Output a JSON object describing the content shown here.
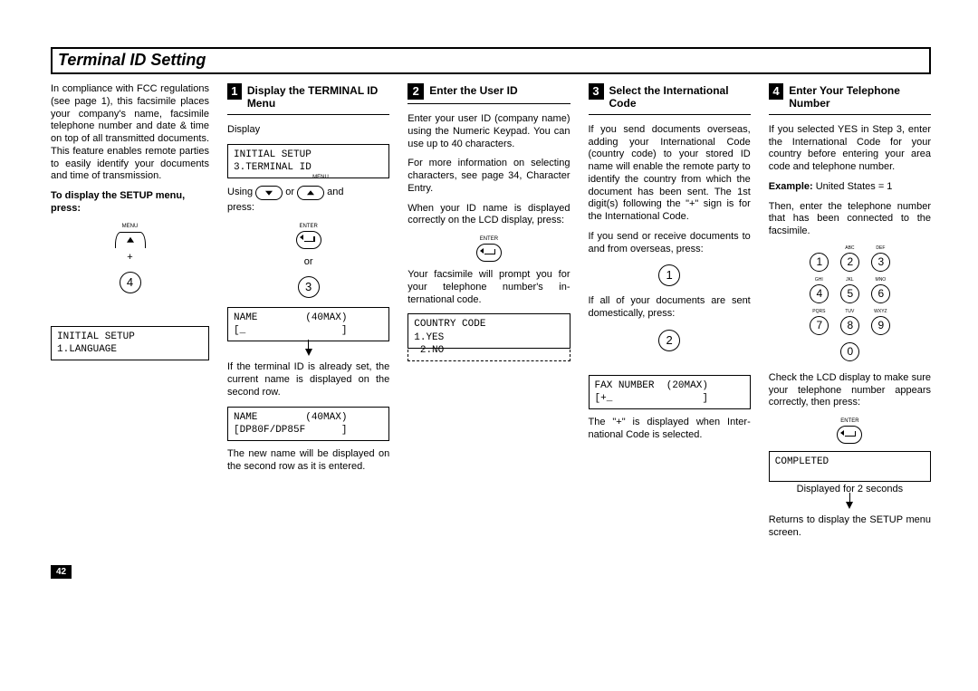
{
  "title": "Terminal ID Setting",
  "page_number": "42",
  "intro": {
    "p1": "In compliance with FCC regula­tions (see page 1), this facsimile places your company's name, facsimile telephone number and date & time on top of all trans­mitted documents. This feature enables remote parties to easily identify your documents and time of transmission.",
    "bold_line": "To display the SETUP menu, press:",
    "plus": "+",
    "key4": "4",
    "menu_label": "MENU",
    "lcd1_l1": "INITIAL SETUP",
    "lcd1_l2": "1.LANGUAGE"
  },
  "step1": {
    "num": "1",
    "title": "Display the TERMINAL ID Menu",
    "display_word": "Display",
    "lcd1_l1": "INITIAL SETUP",
    "lcd1_l2": "3.TERMINAL ID",
    "using": "Using",
    "or_word": "or",
    "and_word": "and",
    "press_word": "press:",
    "enter_label": "ENTER",
    "menu_label": "MENU",
    "key3": "3",
    "lcd2_l1": "NAME        (40MAX)",
    "lcd2_l2": "[_                ]",
    "p1": "If the terminal ID is already set, the current name is displayed on the second row.",
    "lcd3_l1": "NAME        (40MAX)",
    "lcd3_l2": "[DP80F/DP85F      ]",
    "p2": "The new name will be displayed on the second row as it is en­tered."
  },
  "step2": {
    "num": "2",
    "title": "Enter the User ID",
    "p1": "Enter your user ID (company name) using the Numeric Key­pad. You can use up to 40 char­acters.",
    "p2": "For more information on select­ing characters, see page 34, Character Entry.",
    "p3": "When your ID name is displayed correctly on the LCD display, press:",
    "enter_label": "ENTER",
    "p4": "Your facsimile will prompt you for your telephone number's in­ternational code.",
    "lcd1_l1": "COUNTRY CODE",
    "lcd1_l2": "1.YES",
    "lcd1_l3": " 2.NO"
  },
  "step3": {
    "num": "3",
    "title": "Select the International Code",
    "p1": "If you send documents over­seas, adding your International Code (country code) to your stored ID name will enable the remote party to identify the country from which the docu­ment has been sent. The 1st digit(s) following the \"+\" sign is for the International Code.",
    "p2": "If you send or receive docu­ments to and from overseas, press:",
    "key1": "1",
    "p3": "If all of your documents are sent domestically, press:",
    "key2": "2",
    "lcd1_l1": "FAX NUMBER  (20MAX)",
    "lcd1_l2": "[+_               ]",
    "p4": "The \"+\" is displayed when Inter­national Code is selected."
  },
  "step4": {
    "num": "4",
    "title": "Enter Your Telephone Number",
    "p1": "If you selected YES in Step 3, enter the International Code for your country before entering your area code and telephone number.",
    "example_b": "Example:",
    "example_t": " United States = 1",
    "p2": "Then, enter the telephone num­ber that has been connected to the facsimile.",
    "keys": {
      "k1": "1",
      "k2": "2",
      "k3": "3",
      "k4": "4",
      "k5": "5",
      "k6": "6",
      "k7": "7",
      "k8": "8",
      "k9": "9",
      "k0": "0"
    },
    "klabels": {
      "l2": "ABC",
      "l3": "DEF",
      "l4": "GHI",
      "l5": "JKL",
      "l6": "MNO",
      "l7": "PQRS",
      "l8": "TUV",
      "l9": "WXYZ"
    },
    "p3": "Check the LCD display to make sure your telephone number appears correctly, then press:",
    "enter_label": "ENTER",
    "lcd1_l1": "COMPLETED",
    "caption": "Displayed for 2 seconds",
    "p4": "Returns to display the SETUP menu screen."
  }
}
